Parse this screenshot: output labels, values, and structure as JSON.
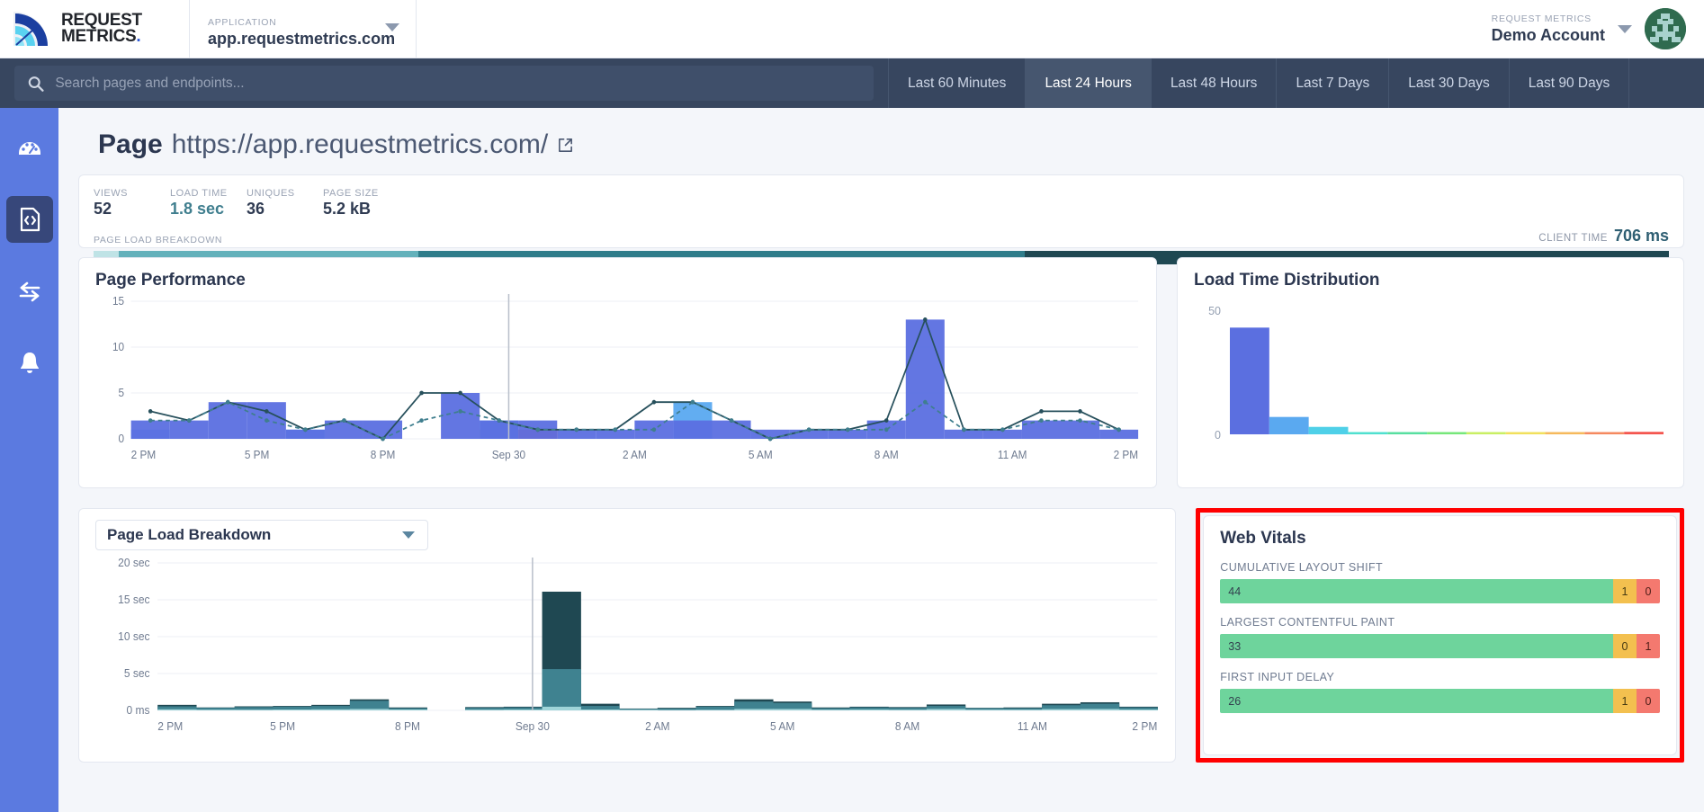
{
  "brand": {
    "line1": "REQUEST",
    "line2": "METRICS",
    "dot": "."
  },
  "app_selector": {
    "kicker": "APPLICATION",
    "value": "app.requestmetrics.com"
  },
  "account": {
    "kicker": "REQUEST METRICS",
    "name": "Demo Account"
  },
  "search": {
    "placeholder": "Search pages and endpoints...",
    "value": ""
  },
  "ranges": [
    {
      "label": "Last 60 Minutes",
      "active": false
    },
    {
      "label": "Last 24 Hours",
      "active": true
    },
    {
      "label": "Last 48 Hours",
      "active": false
    },
    {
      "label": "Last 7 Days",
      "active": false
    },
    {
      "label": "Last 30 Days",
      "active": false
    },
    {
      "label": "Last 90 Days",
      "active": false
    }
  ],
  "rail": [
    {
      "icon": "dashboard-gauge-icon",
      "active": false
    },
    {
      "icon": "code-page-icon",
      "active": true
    },
    {
      "icon": "transfer-arrows-icon",
      "active": false
    },
    {
      "icon": "bell-icon",
      "active": false
    }
  ],
  "page": {
    "prefix": "Page",
    "url": "https://app.requestmetrics.com/"
  },
  "summary": {
    "stats": [
      {
        "label": "VIEWS",
        "value": "52",
        "accent": false
      },
      {
        "label": "LOAD TIME",
        "value": "1.8 sec",
        "accent": true
      },
      {
        "label": "UNIQUES",
        "value": "36",
        "accent": false
      },
      {
        "label": "PAGE SIZE",
        "value": "5.2 kB",
        "accent": false
      }
    ],
    "breakdown_label": "PAGE LOAD BREAKDOWN",
    "client_time_label": "CLIENT TIME",
    "client_time_value": "706 ms",
    "segments": [
      {
        "name": "dns",
        "pct": 1.6,
        "color": "#bfe3e6"
      },
      {
        "name": "connect",
        "pct": 19.0,
        "color": "#63b1bb"
      },
      {
        "name": "server",
        "pct": 38.5,
        "color": "#2f7c8a"
      },
      {
        "name": "client",
        "pct": 40.9,
        "color": "#1f4852"
      }
    ]
  },
  "chart_data": [
    {
      "id": "page-performance",
      "type": "bar",
      "title": "Page Performance",
      "xlabel": "",
      "ylabel": "",
      "ylim": [
        0,
        15
      ],
      "yticks": [
        0,
        5,
        10,
        15
      ],
      "grid": true,
      "xticks": [
        "2 PM",
        "5 PM",
        "8 PM",
        "Sep 30",
        "2 AM",
        "5 AM",
        "8 AM",
        "11 AM",
        "2 PM"
      ],
      "marker_line_x_label": "Sep 30",
      "series": [
        {
          "name": "fast",
          "color": "#5b6fe0",
          "values": [
            2,
            2,
            4,
            4,
            1,
            2,
            2,
            0,
            5,
            2,
            2,
            1,
            1,
            2,
            2,
            2,
            1,
            1,
            1,
            2,
            13,
            1,
            1,
            2,
            2,
            1
          ]
        },
        {
          "name": "medium",
          "color": "#5aa9f0",
          "values": [
            1,
            0,
            0,
            0,
            1,
            0,
            0,
            0,
            0,
            2,
            0,
            0,
            0,
            0,
            4,
            0,
            0,
            0,
            0,
            0,
            0,
            0,
            0,
            0,
            0,
            0
          ]
        },
        {
          "name": "slow",
          "color": "#ef4a4a",
          "values": [
            0,
            0,
            0,
            0,
            0,
            0,
            0,
            0,
            0,
            1,
            1,
            0,
            0,
            0,
            0,
            0,
            0,
            0,
            0,
            0,
            0,
            0,
            0,
            0,
            0,
            0
          ]
        }
      ],
      "lines": [
        {
          "name": "total",
          "style": "solid",
          "color": "#27505c",
          "values": [
            3,
            2,
            4,
            3,
            1,
            2,
            0,
            5,
            5,
            2,
            1,
            1,
            1,
            4,
            4,
            2,
            0,
            1,
            1,
            2,
            13,
            1,
            1,
            3,
            3,
            1
          ]
        },
        {
          "name": "average",
          "style": "dashed",
          "color": "#3f7e8e",
          "values": [
            2,
            2,
            4,
            2,
            1,
            2,
            0,
            2,
            3,
            2,
            1,
            1,
            1,
            1,
            4,
            2,
            0,
            1,
            1,
            1,
            4,
            1,
            1,
            2,
            2,
            1
          ]
        }
      ]
    },
    {
      "id": "load-time-distribution",
      "type": "bar",
      "title": "Load Time Distribution",
      "ylim": [
        0,
        50
      ],
      "yticks": [
        0,
        50
      ],
      "grid": false,
      "bins": [
        {
          "value": 43,
          "color": "#5b6fe0"
        },
        {
          "value": 7,
          "color": "#5aa9f0"
        },
        {
          "value": 3,
          "color": "#4fd0e8"
        },
        {
          "value": 0.3,
          "color": "#4fe0cf"
        },
        {
          "value": 0.2,
          "color": "#57dfa0"
        },
        {
          "value": 0.2,
          "color": "#76e77a"
        },
        {
          "value": 0.2,
          "color": "#c9ef63"
        },
        {
          "value": 0.2,
          "color": "#f1e05c"
        },
        {
          "value": 0.2,
          "color": "#f6b95c"
        },
        {
          "value": 0.2,
          "color": "#f5895f"
        },
        {
          "value": 1.0,
          "color": "#f4564f"
        }
      ]
    },
    {
      "id": "page-load-breakdown",
      "type": "area",
      "title": "Page Load Breakdown",
      "selector_value": "Page Load Breakdown",
      "ylim": [
        0,
        20
      ],
      "yticks": [
        "0 ms",
        "5 sec",
        "10 sec",
        "15 sec",
        "20 sec"
      ],
      "ytick_values": [
        0,
        5,
        10,
        15,
        20
      ],
      "grid": true,
      "xticks": [
        "2 PM",
        "5 PM",
        "8 PM",
        "Sep 30",
        "2 AM",
        "5 AM",
        "8 AM",
        "11 AM",
        "2 PM"
      ],
      "marker_line_x_label": "Sep 30",
      "series": [
        {
          "name": "client",
          "color": "#9fd4d8",
          "values": [
            0.15,
            0.1,
            0.1,
            0.12,
            0.15,
            0.2,
            0.12,
            0,
            0.1,
            0.12,
            0.5,
            0.12,
            0.1,
            0.05,
            0.08,
            0.2,
            0.2,
            0.1,
            0.12,
            0.1,
            0.2,
            0.1,
            0.1,
            0.18,
            0.2,
            0.12
          ]
        },
        {
          "name": "server",
          "color": "#3f8290",
          "values": [
            0.55,
            0.35,
            0.45,
            0.5,
            0.6,
            1.3,
            0.3,
            0,
            0.35,
            0.4,
            5.6,
            0.6,
            0.2,
            0.25,
            0.5,
            1.2,
            1.0,
            0.3,
            0.4,
            0.35,
            0.6,
            0.3,
            0.3,
            0.7,
            0.9,
            0.4
          ]
        },
        {
          "name": "network",
          "color": "#1f4852",
          "values": [
            0.75,
            0.4,
            0.55,
            0.6,
            0.75,
            1.5,
            0.4,
            0,
            0.45,
            0.5,
            16.1,
            0.9,
            0.25,
            0.35,
            0.6,
            1.5,
            1.2,
            0.4,
            0.5,
            0.45,
            0.8,
            0.35,
            0.4,
            0.9,
            1.1,
            0.5
          ]
        }
      ]
    }
  ],
  "web_vitals": {
    "title": "Web Vitals",
    "metrics": [
      {
        "label": "CUMULATIVE LAYOUT SHIFT",
        "good": "44",
        "needs_improvement": "1",
        "poor": "0"
      },
      {
        "label": "LARGEST CONTENTFUL PAINT",
        "good": "33",
        "needs_improvement": "0",
        "poor": "1"
      },
      {
        "label": "FIRST INPUT DELAY",
        "good": "26",
        "needs_improvement": "1",
        "poor": "0"
      }
    ],
    "colors": {
      "good": "#6ed49c",
      "needs_improvement": "#f3c04f",
      "poor": "#f4796f",
      "highlight": "#ff0000"
    }
  }
}
